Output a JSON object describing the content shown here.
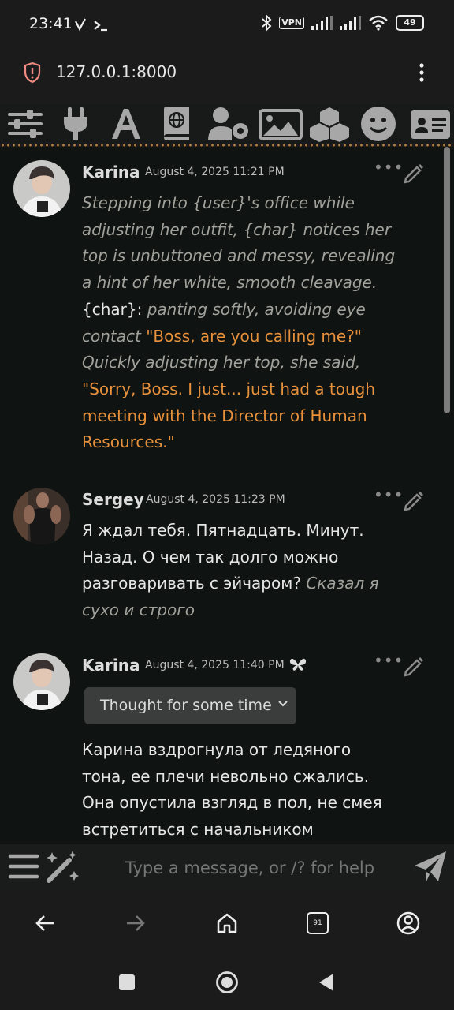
{
  "status": {
    "time": "23:41",
    "vpn_label": "VPN",
    "battery": "49"
  },
  "browser": {
    "url": "127.0.0.1:8000",
    "tab_count": "91"
  },
  "toolbar": {
    "icons": [
      "sliders-icon",
      "plug-icon",
      "font-icon",
      "book-globe-icon",
      "user-gear-icon",
      "image-icon",
      "cubes-icon",
      "smiley-icon",
      "id-card-icon"
    ]
  },
  "messages": [
    {
      "name": "Karina",
      "date": "August 4, 2025 11:21 PM",
      "lines": [
        [
          {
            "t": "Stepping into {user}'s office while",
            "s": "ital"
          }
        ],
        [
          {
            "t": "adjusting her outfit, {char} notices her",
            "s": "ital"
          }
        ],
        [
          {
            "t": "top is unbuttoned and messy, revealing",
            "s": "ital"
          }
        ],
        [
          {
            "t": "a hint of her white, smooth cleavage.",
            "s": "ital"
          }
        ],
        [
          {
            "t": "{char}: ",
            "s": "norm"
          },
          {
            "t": "panting softly, avoiding eye",
            "s": "ital"
          }
        ],
        [
          {
            "t": "contact ",
            "s": "ital"
          },
          {
            "t": "\"Boss, are you calling me?\"",
            "s": "quote"
          }
        ],
        [
          {
            "t": "Quickly adjusting her top, she said,",
            "s": "ital"
          }
        ],
        [
          {
            "t": "\"Sorry, Boss. I just... just had a tough",
            "s": "quote"
          }
        ],
        [
          {
            "t": "meeting with the Director of Human",
            "s": "quote"
          }
        ],
        [
          {
            "t": "Resources.\"",
            "s": "quote"
          }
        ]
      ]
    },
    {
      "name": "Sergey",
      "date": "August 4, 2025 11:23 PM",
      "lines": [
        [
          {
            "t": "Я ждал тебя. Пятнадцать. Минут.",
            "s": "norm"
          }
        ],
        [
          {
            "t": "Назад. О чем так долго можно",
            "s": "norm"
          }
        ],
        [
          {
            "t": "разговаривать с эйчаром? ",
            "s": "norm"
          },
          {
            "t": "Сказал я",
            "s": "ital"
          }
        ],
        [
          {
            "t": "сухо и строго",
            "s": "ital"
          }
        ]
      ]
    },
    {
      "name": "Karina",
      "date": "August 4, 2025 11:40 PM",
      "thought_label": "Thought for some time",
      "lines": [
        [
          {
            "t": "Карина вздрогнула от ледяного",
            "s": "norm"
          }
        ],
        [
          {
            "t": "тона, ее плечи невольно сжались.",
            "s": "norm"
          }
        ],
        [
          {
            "t": "Она опустила взгляд в пол, не смея",
            "s": "norm"
          }
        ],
        [
          {
            "t": "встретиться с начальником",
            "s": "norm"
          }
        ]
      ]
    }
  ],
  "input": {
    "placeholder": "Type a message, or /? for help"
  }
}
